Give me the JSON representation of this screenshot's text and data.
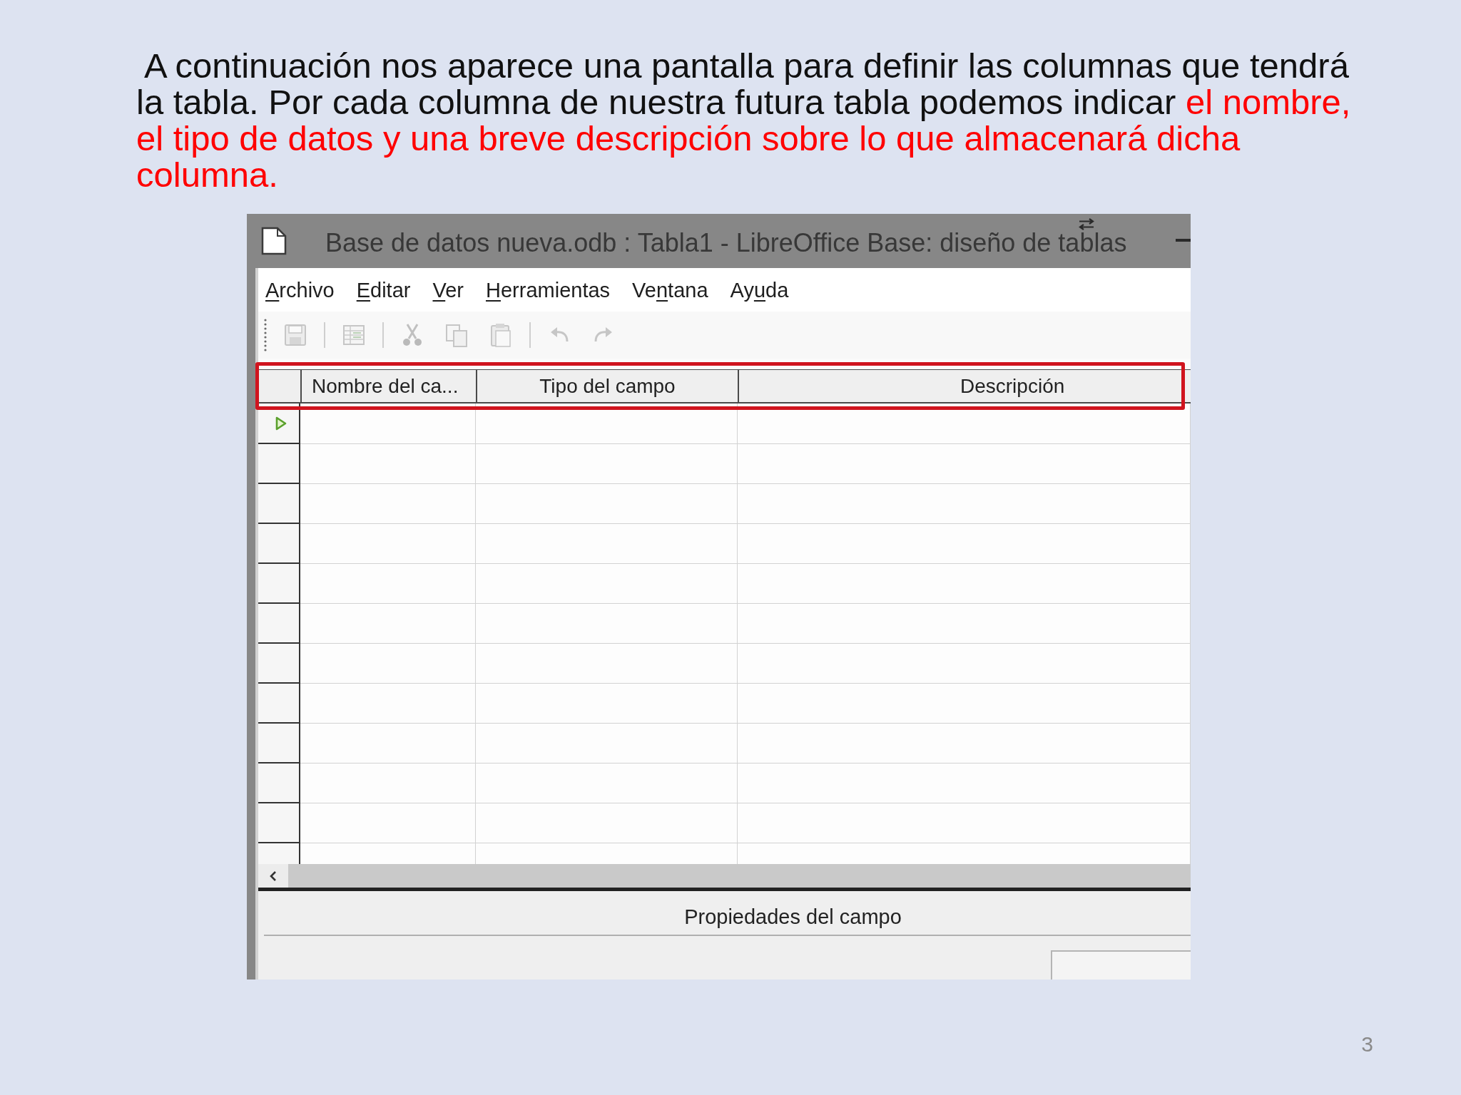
{
  "slide": {
    "paragraph": [
      {
        "text": "A continuación nos aparece una pantalla para definir las columnas que tendrá la tabla. Por cada columna de nuestra futura tabla podemos indicar ",
        "highlighted": false
      },
      {
        "text": "el nombre, el tipo de datos y una breve descripción sobre lo que almacenará dicha columna.",
        "highlighted": true
      }
    ],
    "page_number": "3"
  },
  "window": {
    "title": "Base de datos nueva.odb : Tabla1 - LibreOffice Base: diseño de tablas",
    "menu": [
      {
        "parts": [
          {
            "text": "A",
            "underlined": true
          },
          {
            "text": "rchivo",
            "underlined": false
          }
        ]
      },
      {
        "parts": [
          {
            "text": "E",
            "underlined": true
          },
          {
            "text": "ditar",
            "underlined": false
          }
        ]
      },
      {
        "parts": [
          {
            "text": "V",
            "underlined": true
          },
          {
            "text": "er",
            "underlined": false
          }
        ]
      },
      {
        "parts": [
          {
            "text": "H",
            "underlined": true
          },
          {
            "text": "erramientas",
            "underlined": false
          }
        ]
      },
      {
        "parts": [
          {
            "text": "Ve",
            "underlined": false
          },
          {
            "text": "n",
            "underlined": true
          },
          {
            "text": "tana",
            "underlined": false
          }
        ]
      },
      {
        "parts": [
          {
            "text": "Ay",
            "underlined": false
          },
          {
            "text": "u",
            "underlined": true
          },
          {
            "text": "da",
            "underlined": false
          }
        ]
      }
    ],
    "toolbar": [
      {
        "kind": "grip"
      },
      {
        "kind": "button",
        "disabled": true
      },
      {
        "kind": "separator"
      },
      {
        "kind": "button",
        "disabled": true
      },
      {
        "kind": "separator"
      },
      {
        "kind": "button",
        "disabled": true
      },
      {
        "kind": "button",
        "disabled": true
      },
      {
        "kind": "button",
        "disabled": true
      },
      {
        "kind": "separator"
      },
      {
        "kind": "button",
        "disabled": true
      },
      {
        "kind": "button",
        "disabled": true
      }
    ],
    "table": {
      "columns": [
        "Nombre del ca...",
        "Tipo del campo",
        "Descripción"
      ],
      "header_highlighted": true,
      "rows": [
        {
          "current": true
        },
        {
          "current": false
        },
        {
          "current": false
        },
        {
          "current": false
        },
        {
          "current": false
        },
        {
          "current": false
        },
        {
          "current": false
        },
        {
          "current": false
        },
        {
          "current": false
        },
        {
          "current": false
        },
        {
          "current": false
        },
        {
          "current": false
        }
      ]
    },
    "properties_panel": {
      "title": "Propiedades del campo"
    }
  }
}
